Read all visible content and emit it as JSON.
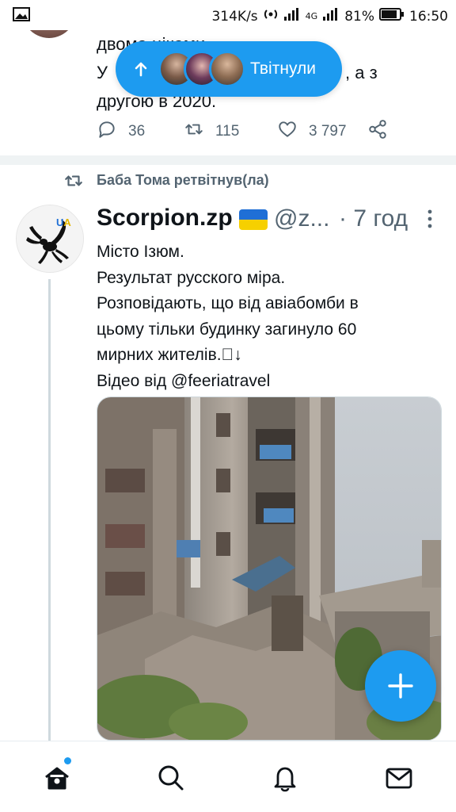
{
  "status_bar": {
    "speed": "314K/s",
    "network": "4G",
    "battery": "81%",
    "time": "16:50"
  },
  "previous_tweet": {
    "lines": [
      "двома ціками",
      "У",
      "другою в 2020."
    ],
    "line_tail": ", а з",
    "replies": "36",
    "retweets": "115",
    "likes": "3 797"
  },
  "retweeted_pill": {
    "label": "Твітнули"
  },
  "retweet_header": {
    "text": "Баба Тома ретвітнув(ла)"
  },
  "tweet": {
    "display_name": "Scorpion.zp",
    "handle": "@z...",
    "time": "· 7 год",
    "avatar_badge": "UA",
    "lines": [
      "Місто Ізюм.",
      "Результат русского міра.",
      "Розповідають, що від авіабомби в",
      "цьому тільки будинку загинуло 60",
      "мирних жителів.\u0000↓",
      "Відео від @feeriatravel"
    ]
  },
  "colors": {
    "accent": "#1d9bf0",
    "secondary_text": "#536471",
    "flag_blue": "#1f6fd6",
    "flag_yellow": "#f6d000"
  },
  "icons": {
    "reply": "speech-bubble-icon",
    "retweet": "retweet-icon",
    "like": "heart-icon",
    "share": "share-icon",
    "compose": "plus-icon",
    "nav": [
      "home-icon",
      "search-icon",
      "bell-icon",
      "mail-icon"
    ]
  }
}
